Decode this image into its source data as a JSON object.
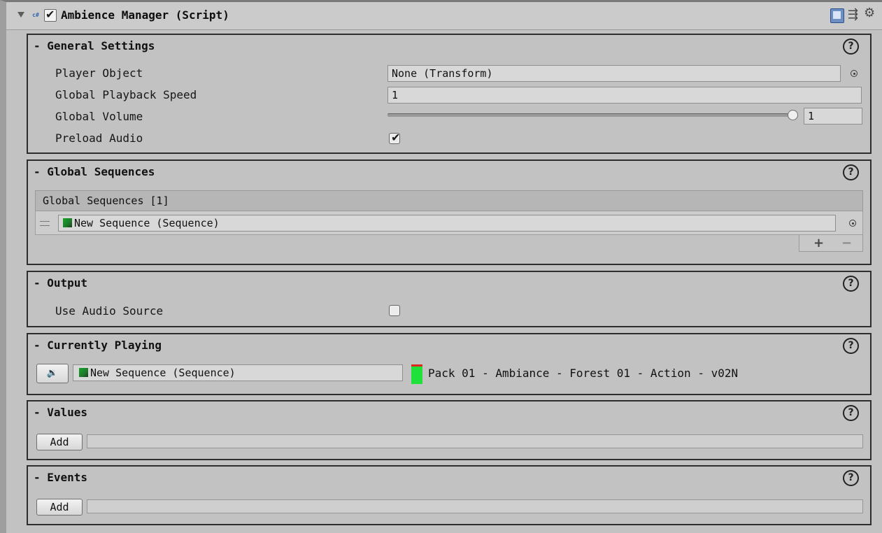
{
  "header": {
    "title": "Ambience Manager (Script)",
    "enabled": true,
    "icons": [
      "foldout-arrow-icon",
      "csharp-script-icon",
      "reference-book-icon",
      "preset-icon",
      "gear-icon"
    ]
  },
  "general_settings": {
    "title": "- General Settings",
    "help": "?",
    "player_object": {
      "label": "Player Object",
      "value": "None (Transform)"
    },
    "playback_speed": {
      "label": "Global Playback Speed",
      "value": "1"
    },
    "volume": {
      "label": "Global Volume",
      "value": "1",
      "slider_fraction": 1.0
    },
    "preload": {
      "label": "Preload Audio",
      "checked": true
    }
  },
  "global_sequences": {
    "title": "- Global Sequences",
    "help": "?",
    "list_header": "Global Sequences [1]",
    "items": [
      {
        "value": "New Sequence (Sequence)"
      }
    ],
    "add_label": "+",
    "remove_label": "−"
  },
  "output": {
    "title": "- Output",
    "help": "?",
    "use_audio_source": {
      "label": "Use Audio Source",
      "checked": false
    }
  },
  "currently_playing": {
    "title": "- Currently Playing",
    "help": "?",
    "play_button_icon": "🔉",
    "sequence": "New Sequence (Sequence)",
    "track": "Pack 01 - Ambiance - Forest 01 - Action - v02N",
    "meter_colors": {
      "level": "#1ee23a",
      "peak": "#dc2a20"
    }
  },
  "values": {
    "title": "- Values",
    "help": "?",
    "add_label": "Add"
  },
  "events": {
    "title": "- Events",
    "help": "?",
    "add_label": "Add"
  }
}
